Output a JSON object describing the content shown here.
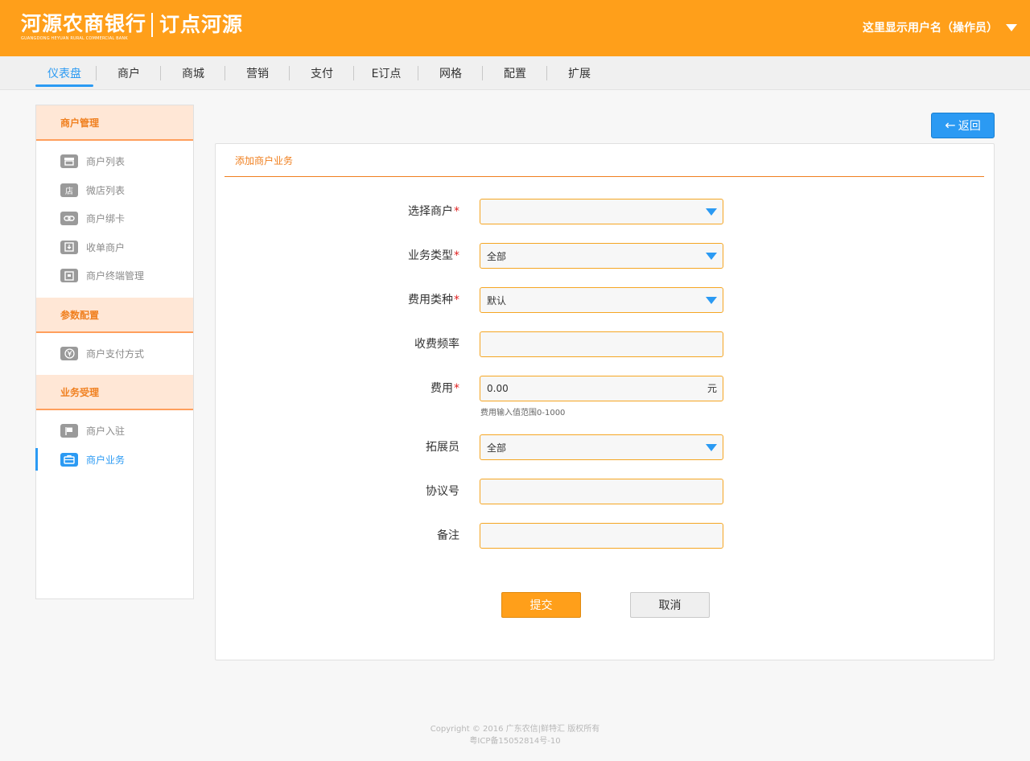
{
  "header": {
    "bank_name": "河源农商银行",
    "bank_name_en": "GUANGDONG HEYUAN RURAL COMMERCIAL BANK",
    "product_name": "订点河源",
    "user_label": "这里显示用户名（操作员）",
    "brand_color": "#ff9f1a"
  },
  "nav": {
    "items": [
      {
        "label": "仪表盘",
        "active": true
      },
      {
        "label": "商户"
      },
      {
        "label": "商城"
      },
      {
        "label": "营销"
      },
      {
        "label": "支付"
      },
      {
        "label": "E订点"
      },
      {
        "label": "网格"
      },
      {
        "label": "配置"
      },
      {
        "label": "扩展"
      }
    ],
    "accent_color": "#2b9af3"
  },
  "sidebar": {
    "sections": [
      {
        "title": "商户管理",
        "items": [
          {
            "label": "商户列表",
            "icon": "store-icon"
          },
          {
            "label": "微店列表",
            "icon": "shop-icon"
          },
          {
            "label": "商户绑卡",
            "icon": "link-icon"
          },
          {
            "label": "收单商户",
            "icon": "download-icon"
          },
          {
            "label": "商户终端管理",
            "icon": "terminal-icon"
          }
        ]
      },
      {
        "title": "参数配置",
        "items": [
          {
            "label": "商户支付方式",
            "icon": "yuan-icon"
          }
        ]
      },
      {
        "title": "业务受理",
        "items": [
          {
            "label": "商户入驻",
            "icon": "flag-icon"
          },
          {
            "label": "商户业务",
            "icon": "briefcase-icon",
            "active": true
          }
        ]
      }
    ]
  },
  "back_button": {
    "label": "返回"
  },
  "panel": {
    "title": "添加商户业务",
    "fields": [
      {
        "label": "选择商户",
        "required": true,
        "type": "select",
        "value": ""
      },
      {
        "label": "业务类型",
        "required": true,
        "type": "select",
        "value": "全部"
      },
      {
        "label": "费用类种",
        "required": true,
        "type": "select",
        "value": "默认"
      },
      {
        "label": "收费频率",
        "required": false,
        "type": "input",
        "value": ""
      },
      {
        "label": "费用",
        "required": true,
        "type": "input",
        "value": "0.00",
        "unit": "元",
        "hint": "费用输入值范围0-1000"
      },
      {
        "label": "拓展员",
        "required": false,
        "type": "select",
        "value": "全部"
      },
      {
        "label": "协议号",
        "required": false,
        "type": "input",
        "value": ""
      },
      {
        "label": "备注",
        "required": false,
        "type": "input",
        "value": ""
      }
    ],
    "submit_label": "提交",
    "cancel_label": "取消"
  },
  "footer": {
    "copyright": "Copyright © 2016 广东农信|鲜特汇 版权所有",
    "icp": "粤ICP备15052814号-10"
  }
}
